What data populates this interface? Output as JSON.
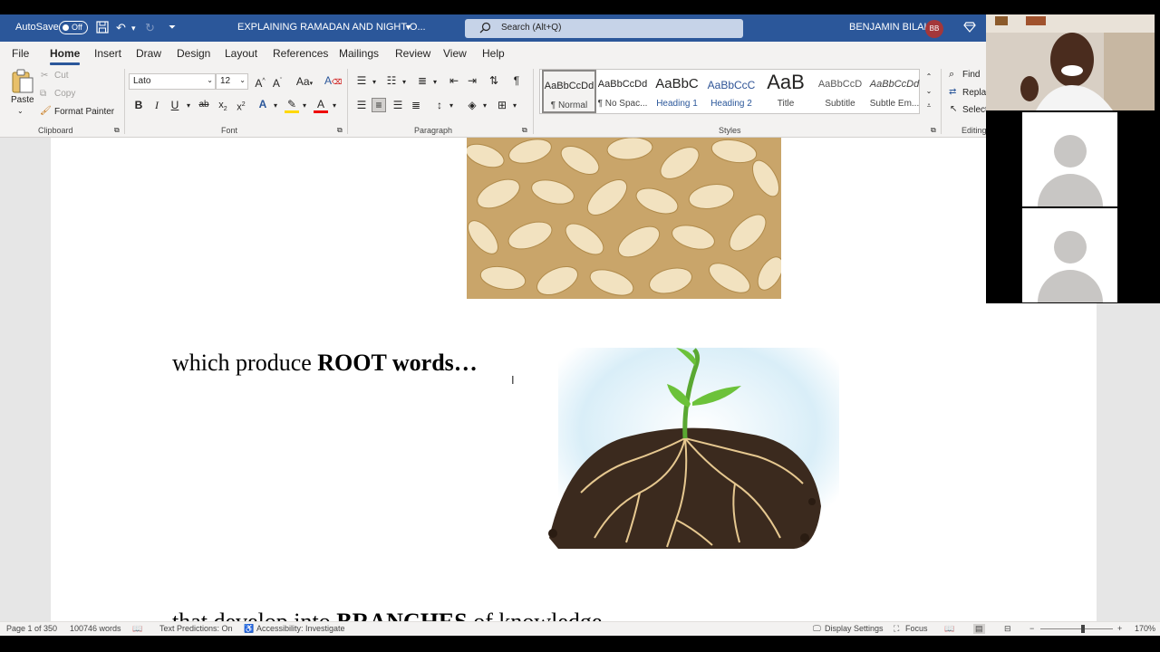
{
  "titlebar": {
    "autosave_label": "AutoSave",
    "autosave_state": "Off",
    "doc_title": "EXPLAINING RAMADAN AND NIGHT O...",
    "search_placeholder": "Search (Alt+Q)",
    "user_name": "BENJAMIN BILAL",
    "user_initials": "BB",
    "accent_color": "#2b579a"
  },
  "menu": {
    "tabs": [
      "File",
      "Home",
      "Insert",
      "Draw",
      "Design",
      "Layout",
      "References",
      "Mailings",
      "Review",
      "View",
      "Help"
    ],
    "active": "Home"
  },
  "ribbon": {
    "clipboard": {
      "paste": "Paste",
      "cut": "Cut",
      "copy": "Copy",
      "format_painter": "Format Painter",
      "label": "Clipboard"
    },
    "font": {
      "name": "Lato",
      "size": "12",
      "label": "Font"
    },
    "paragraph": {
      "label": "Paragraph"
    },
    "styles": {
      "label": "Styles",
      "items": [
        {
          "preview": "AaBbCcDd",
          "name": "¶ Normal"
        },
        {
          "preview": "AaBbCcDd",
          "name": "¶ No Spac..."
        },
        {
          "preview": "AaBbC",
          "name": "Heading 1"
        },
        {
          "preview": "AaBbCcC",
          "name": "Heading 2"
        },
        {
          "preview": "AaB",
          "name": "Title"
        },
        {
          "preview": "AaBbCcD",
          "name": "Subtitle"
        },
        {
          "preview": "AaBbCcDd",
          "name": "Subtle Em..."
        }
      ]
    },
    "editing": {
      "find": "Find",
      "replace": "Repla",
      "select": "Select",
      "label": "Editing"
    }
  },
  "document": {
    "line1_plain": "which produce ",
    "line1_bold": "ROOT words…",
    "line2_plain1": "that develop into ",
    "line2_bold": "BRANCHES",
    "line2_plain2": " of knowledge"
  },
  "statusbar": {
    "page": "Page 1 of 350",
    "words": "100746 words",
    "text_predictions": "Text Predictions: On",
    "accessibility": "Accessibility: Investigate",
    "display_settings": "Display Settings",
    "focus": "Focus",
    "zoom": "170%"
  }
}
